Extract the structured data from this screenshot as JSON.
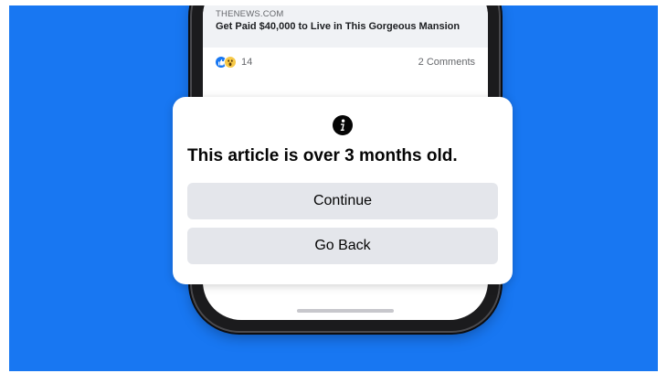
{
  "post": {
    "link_source": "THENEWS.COM",
    "link_headline": "Get Paid $40,000 to Live in This Gorgeous Mansion",
    "reaction_count": "14",
    "comments_count": "2 Comments",
    "reactions": [
      "like-icon",
      "wow-icon"
    ]
  },
  "dialog": {
    "icon": "info-icon",
    "message": "This article is over 3 months old.",
    "continue_label": "Continue",
    "go_back_label": "Go Back"
  },
  "colors": {
    "background": "#1877f2",
    "button_bg": "#e4e6eb",
    "text": "#050505"
  }
}
